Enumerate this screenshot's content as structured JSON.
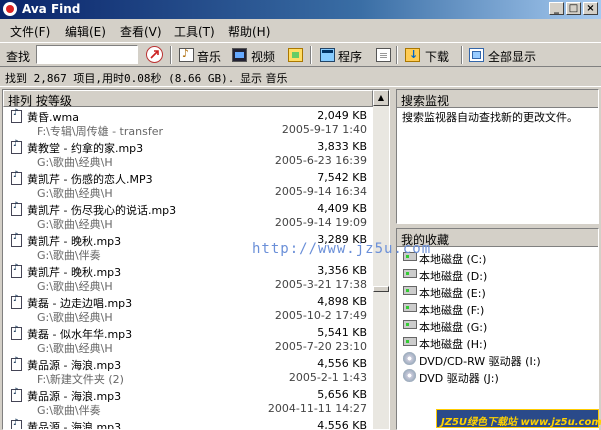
{
  "window": {
    "title": "Ava Find",
    "buttons": {
      "minimize": "_",
      "maximize": "□",
      "close": "×"
    }
  },
  "menu": [
    {
      "label": "文件(F)"
    },
    {
      "label": "编辑(E)"
    },
    {
      "label": "查看(V)"
    },
    {
      "label": "工具(T)"
    },
    {
      "label": "帮助(H)"
    }
  ],
  "toolbar": {
    "search_label": "查找",
    "search_value": "",
    "music_label": "音乐",
    "video_label": "视频",
    "program_label": "程序",
    "download_label": "下载",
    "show_all_label": "全部显示",
    "icons": [
      "go-icon",
      "music-icon",
      "video-icon",
      "picture-icon",
      "program-icon",
      "document-icon",
      "download-icon",
      "show-all-icon"
    ]
  },
  "status": {
    "summary": "找到 2,867 项目,用时0.08秒 (8.66 GB).",
    "filter": "显示 音乐"
  },
  "list": {
    "header": "排列 按等级",
    "rows": [
      {
        "name": "黄昏.wma",
        "size": "2,049 KB",
        "path": "F:\\专辑\\周传雄 - transfer",
        "date": "2005-9-17 1:40"
      },
      {
        "name": "黄教堂 - 约拿的家.mp3",
        "size": "3,833 KB",
        "path": "G:\\歌曲\\经典\\H",
        "date": "2005-6-23 16:39"
      },
      {
        "name": "黄凯芹 - 伤感的恋人.MP3",
        "size": "7,542 KB",
        "path": "G:\\歌曲\\经典\\H",
        "date": "2005-9-14 16:34"
      },
      {
        "name": "黄凯芹 - 伤尽我心的说话.mp3",
        "size": "4,409 KB",
        "path": "G:\\歌曲\\经典\\H",
        "date": "2005-9-14 19:09"
      },
      {
        "name": "黄凯芹 - 晚秋.mp3",
        "size": "3,289 KB",
        "path": "G:\\歌曲\\伴奏",
        "date": ""
      },
      {
        "name": "黄凯芹 - 晚秋.mp3",
        "size": "3,356 KB",
        "path": "G:\\歌曲\\经典\\H",
        "date": "2005-3-21 17:38"
      },
      {
        "name": "黄磊 - 边走边唱.mp3",
        "size": "4,898 KB",
        "path": "G:\\歌曲\\经典\\H",
        "date": "2005-10-2 17:49"
      },
      {
        "name": "黄磊 - 似水年华.mp3",
        "size": "5,541 KB",
        "path": "G:\\歌曲\\经典\\H",
        "date": "2005-7-20 23:10"
      },
      {
        "name": "黄品源 - 海浪.mp3",
        "size": "4,556 KB",
        "path": "F:\\新建文件夹 (2)",
        "date": "2005-2-1 1:43"
      },
      {
        "name": "黄品源 - 海浪.mp3",
        "size": "5,656 KB",
        "path": "G:\\歌曲\\伴奏",
        "date": "2004-11-11 14:27"
      },
      {
        "name": "黄品源 - 海浪.mp3",
        "size": "4,556 KB",
        "path": "",
        "date": ""
      }
    ]
  },
  "monitor": {
    "header": "搜索监视",
    "text": "搜索监视器自动查找新的更改文件。"
  },
  "favorites": {
    "header": "我的收藏",
    "items": [
      {
        "label": "本地磁盘 (C:)",
        "icon": "drive-icon"
      },
      {
        "label": "本地磁盘 (D:)",
        "icon": "drive-icon"
      },
      {
        "label": "本地磁盘 (E:)",
        "icon": "drive-icon"
      },
      {
        "label": "本地磁盘 (F:)",
        "icon": "drive-icon"
      },
      {
        "label": "本地磁盘 (G:)",
        "icon": "drive-icon"
      },
      {
        "label": "本地磁盘 (H:)",
        "icon": "drive-icon"
      },
      {
        "label": "DVD/CD-RW 驱动器 (I:)",
        "icon": "cd-icon"
      },
      {
        "label": "DVD 驱动器 (J:)",
        "icon": "cd-icon"
      }
    ]
  },
  "watermark": "http://www.jz5u.com",
  "banner": "JZ5U绿色下载站 www.jz5u.com"
}
